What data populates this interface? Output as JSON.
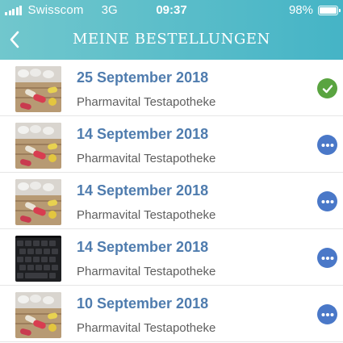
{
  "status_bar": {
    "carrier": "Swisscom",
    "network": "3G",
    "time": "09:37",
    "battery": "98%",
    "battery_level": 0.98
  },
  "header": {
    "title": "MEINE BESTELLUNGEN",
    "back_icon": "chevron-left-icon"
  },
  "orders": [
    {
      "date": "25 September 2018",
      "pharmacy": "Pharmavital Testapotheke",
      "thumbnail": "pills",
      "status_icon": "checkmark-icon"
    },
    {
      "date": "14 September 2018",
      "pharmacy": "Pharmavital Testapotheke",
      "thumbnail": "pills",
      "status_icon": "more-icon"
    },
    {
      "date": "14 September 2018",
      "pharmacy": "Pharmavital Testapotheke",
      "thumbnail": "pills",
      "status_icon": "more-icon"
    },
    {
      "date": "14 September 2018",
      "pharmacy": "Pharmavital Testapotheke",
      "thumbnail": "keyboard",
      "status_icon": "more-icon"
    },
    {
      "date": "10 September 2018",
      "pharmacy": "Pharmavital Testapotheke",
      "thumbnail": "pills",
      "status_icon": "more-icon"
    }
  ],
  "colors": {
    "header_start": "#71c7cd",
    "header_end": "#45b4c6",
    "date_text": "#4f7cae",
    "status_done": "#5aa440",
    "status_more": "#4a78c8"
  }
}
